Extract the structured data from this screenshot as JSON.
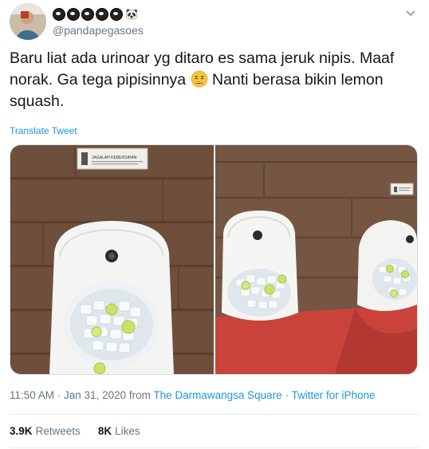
{
  "author": {
    "display_name_icons": [
      "dark-circle-icon",
      "dark-circle-icon",
      "dark-circle-icon",
      "dark-circle-icon",
      "dark-circle-icon",
      "panda-emoji"
    ],
    "panda": "🐼",
    "handle": "@pandapegasoes"
  },
  "tweet": {
    "text_part1": "Baru liat ada urinoar yg ditaro es sama jeruk nipis. Maaf norak. Ga tega pipisinnya ",
    "text_part2": " Nanti berasa bikin lemon squash.",
    "emoji": "weary-face-emoji",
    "translate_label": "Translate Tweet",
    "sign_text": "JAGALAH KEBERSIHAN"
  },
  "meta": {
    "time": "11:50 AM · Jan 31, 2020 from ",
    "location": "The Darmawangsa Square",
    "separator": " · ",
    "source": "Twitter for iPhone"
  },
  "stats": {
    "retweets_count": "3.9K",
    "retweets_label": "Retweets",
    "likes_count": "8K",
    "likes_label": "Likes"
  },
  "colors": {
    "link": "#1b95e0",
    "secondary_text": "#657786",
    "primary_text": "#14171a",
    "wood": "#7a5a44",
    "carpet": "#c53a33"
  }
}
